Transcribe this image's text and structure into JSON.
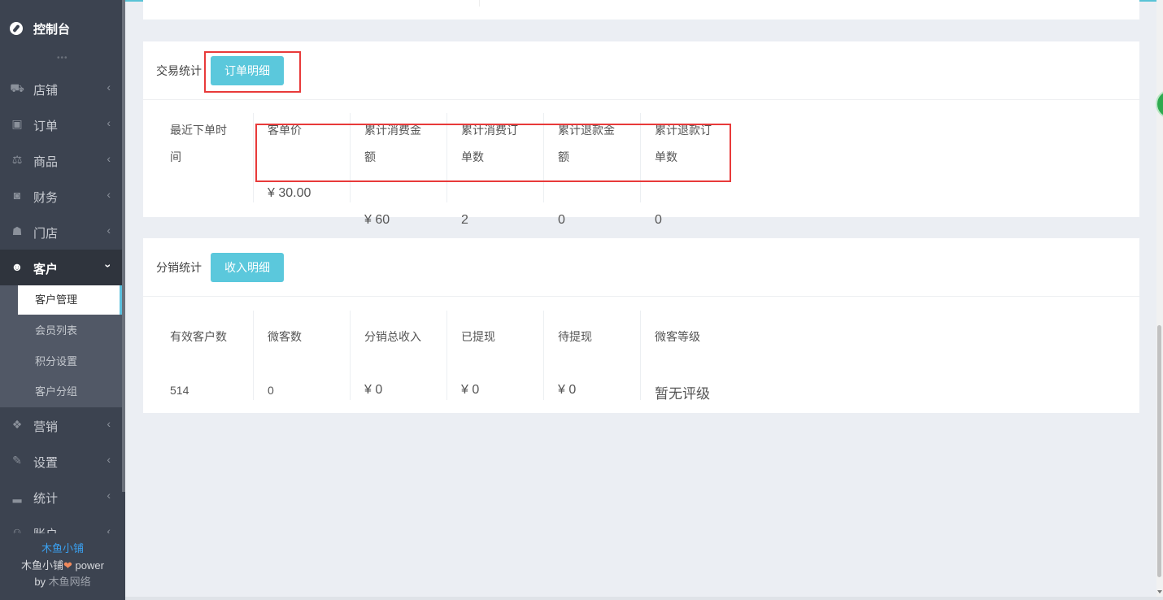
{
  "sidebar": {
    "dashboard": "控制台",
    "dots": "•••",
    "items": [
      {
        "label": "店铺",
        "icon": "basket-icon"
      },
      {
        "label": "订单",
        "icon": "money-icon"
      },
      {
        "label": "商品",
        "icon": "scale-icon"
      },
      {
        "label": "财务",
        "icon": "cash-icon"
      },
      {
        "label": "门店",
        "icon": "sitemap-icon"
      },
      {
        "label": "客户",
        "icon": "users-icon"
      },
      {
        "label": "营销",
        "icon": "gift-icon"
      },
      {
        "label": "设置",
        "icon": "wrench-icon"
      },
      {
        "label": "统计",
        "icon": "signal-icon"
      },
      {
        "label": "账户",
        "icon": "user-icon"
      }
    ],
    "submenu": [
      "客户管理",
      "会员列表",
      "积分设置",
      "客户分组"
    ],
    "footer": {
      "brand": "木鱼小铺",
      "power_prefix": "木鱼小铺",
      "power_suffix": " power",
      "by": "by ",
      "company": "木鱼网络"
    }
  },
  "trade": {
    "title": "交易统计",
    "button": "订单明细",
    "columns": [
      {
        "h1": "最近下单时",
        "h2": "间",
        "value": ""
      },
      {
        "h1": "客单价",
        "h2": "",
        "value": "¥ 30.00"
      },
      {
        "h1": "累计消费金",
        "h2": "额",
        "value": "¥ 60"
      },
      {
        "h1": "累计消费订",
        "h2": "单数",
        "value": "2"
      },
      {
        "h1": "累计退款金",
        "h2": "额",
        "value": "0"
      },
      {
        "h1": "累计退款订",
        "h2": "单数",
        "value": "0"
      }
    ]
  },
  "dist": {
    "title": "分销统计",
    "button": "收入明细",
    "columns": [
      {
        "h": "有效客户数",
        "value": "514"
      },
      {
        "h": "微客数",
        "value": "0"
      },
      {
        "h": "分销总收入",
        "value": "¥ 0"
      },
      {
        "h": "已提现",
        "value": "¥ 0"
      },
      {
        "h": "待提现",
        "value": "¥ 0"
      },
      {
        "h": "微客等级",
        "value": "暂无评级"
      }
    ]
  },
  "colors": {
    "accent": "#5bc8dc",
    "highlight": "#e83a3a",
    "sidebar": "#3c4350"
  }
}
